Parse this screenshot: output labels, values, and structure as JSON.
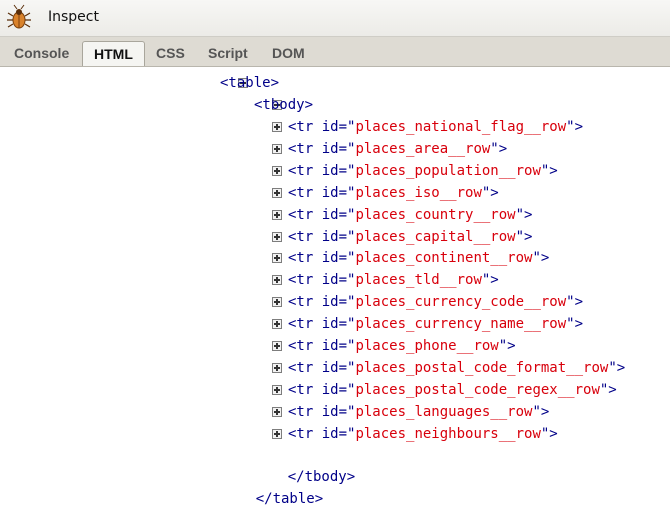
{
  "toolbar": {
    "inspect_label": "Inspect",
    "logo_icon": "firebug-icon"
  },
  "tabs": [
    {
      "label": "Console",
      "active": false
    },
    {
      "label": "HTML",
      "active": true
    },
    {
      "label": "CSS",
      "active": false
    },
    {
      "label": "Script",
      "active": false
    },
    {
      "label": "DOM",
      "active": false
    }
  ],
  "tree": {
    "table_open": "<table>",
    "tbody_open": "<tbody>",
    "rows": [
      {
        "prefix": "<tr id=\"",
        "value": "places_national_flag__row",
        "suffix": "\">"
      },
      {
        "prefix": "<tr id=\"",
        "value": "places_area__row",
        "suffix": "\">"
      },
      {
        "prefix": "<tr id=\"",
        "value": "places_population__row",
        "suffix": "\">"
      },
      {
        "prefix": "<tr id=\"",
        "value": "places_iso__row",
        "suffix": "\">"
      },
      {
        "prefix": "<tr id=\"",
        "value": "places_country__row",
        "suffix": "\">"
      },
      {
        "prefix": "<tr id=\"",
        "value": "places_capital__row",
        "suffix": "\">"
      },
      {
        "prefix": "<tr id=\"",
        "value": "places_continent__row",
        "suffix": "\">"
      },
      {
        "prefix": "<tr id=\"",
        "value": "places_tld__row",
        "suffix": "\">"
      },
      {
        "prefix": "<tr id=\"",
        "value": "places_currency_code__row",
        "suffix": "\">"
      },
      {
        "prefix": "<tr id=\"",
        "value": "places_currency_name__row",
        "suffix": "\">"
      },
      {
        "prefix": "<tr id=\"",
        "value": "places_phone__row",
        "suffix": "\">"
      },
      {
        "prefix": "<tr id=\"",
        "value": "places_postal_code_format__row",
        "suffix": "\">"
      },
      {
        "prefix": "<tr id=\"",
        "value": "places_postal_code_regex__row",
        "suffix": "\">"
      },
      {
        "prefix": "<tr id=\"",
        "value": "places_languages__row",
        "suffix": "\">"
      },
      {
        "prefix": "<tr id=\"",
        "value": "places_neighbours__row",
        "suffix": "\">"
      }
    ],
    "tbody_close": "</tbody>",
    "table_close": "</table>"
  }
}
